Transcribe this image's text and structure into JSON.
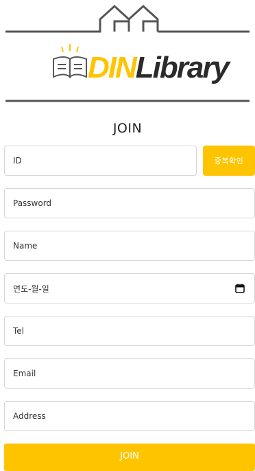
{
  "logo": {
    "brand_part1": "DIN",
    "brand_part2": "Library",
    "accent_color": "#ffc400"
  },
  "form": {
    "title": "JOIN",
    "fields": {
      "id_placeholder": "ID",
      "password_placeholder": "Password",
      "name_placeholder": "Name",
      "date_placeholder": "연도-월-일",
      "tel_placeholder": "Tel",
      "email_placeholder": "Email",
      "address_placeholder": "Address"
    },
    "duplicate_check_label": "중복확인",
    "submit_label": "JOIN"
  },
  "icons": {
    "calendar": "calendar-icon",
    "house": "house-outline-icon",
    "book": "open-book-icon"
  }
}
